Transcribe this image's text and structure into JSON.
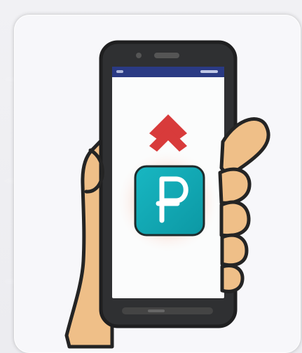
{
  "app": {
    "kind": "payment-illustration",
    "currency_symbol": "₽"
  },
  "colors": {
    "background": "#f1f1f4",
    "card": "#f7f7fa",
    "phone_body": "#2f3032",
    "status_bar": "#2a3a84",
    "screen": "#fbfcfc",
    "arrow": "#d83b3b",
    "app_icon": "#12a9b4",
    "app_icon_glow": "#f6b7a2",
    "hand": "#f0c08a",
    "hand_outline": "#222222"
  },
  "icons": {
    "primary": "ruble-app-icon",
    "gesture": "swipe-up-arrows-icon"
  }
}
